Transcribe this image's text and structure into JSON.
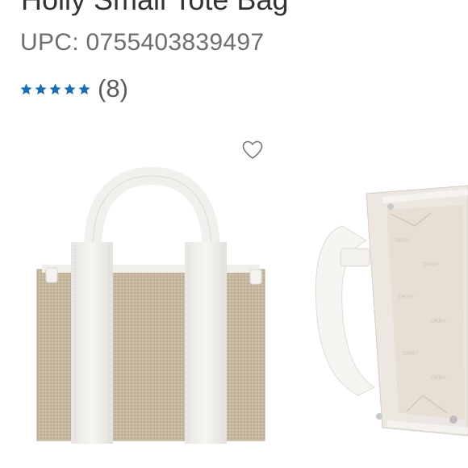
{
  "product": {
    "title": "Holly Small Tote Bag",
    "upc_label": "UPC: 0755403839497",
    "rating": {
      "stars": 5,
      "star_icon": "star-icon",
      "star_color": "#1a6fb4",
      "review_count_text": "(8)"
    },
    "favorite": {
      "icon": "heart-outline-icon"
    }
  },
  "gallery": {
    "images": [
      {
        "name": "tote-front-view",
        "colors": {
          "canvas": "#c9b9a3",
          "leather": "#f3f2ee"
        }
      },
      {
        "name": "tote-interior-view",
        "colors": {
          "lining": "#e6ddd3",
          "leather": "#f3f2ee"
        }
      }
    ]
  }
}
